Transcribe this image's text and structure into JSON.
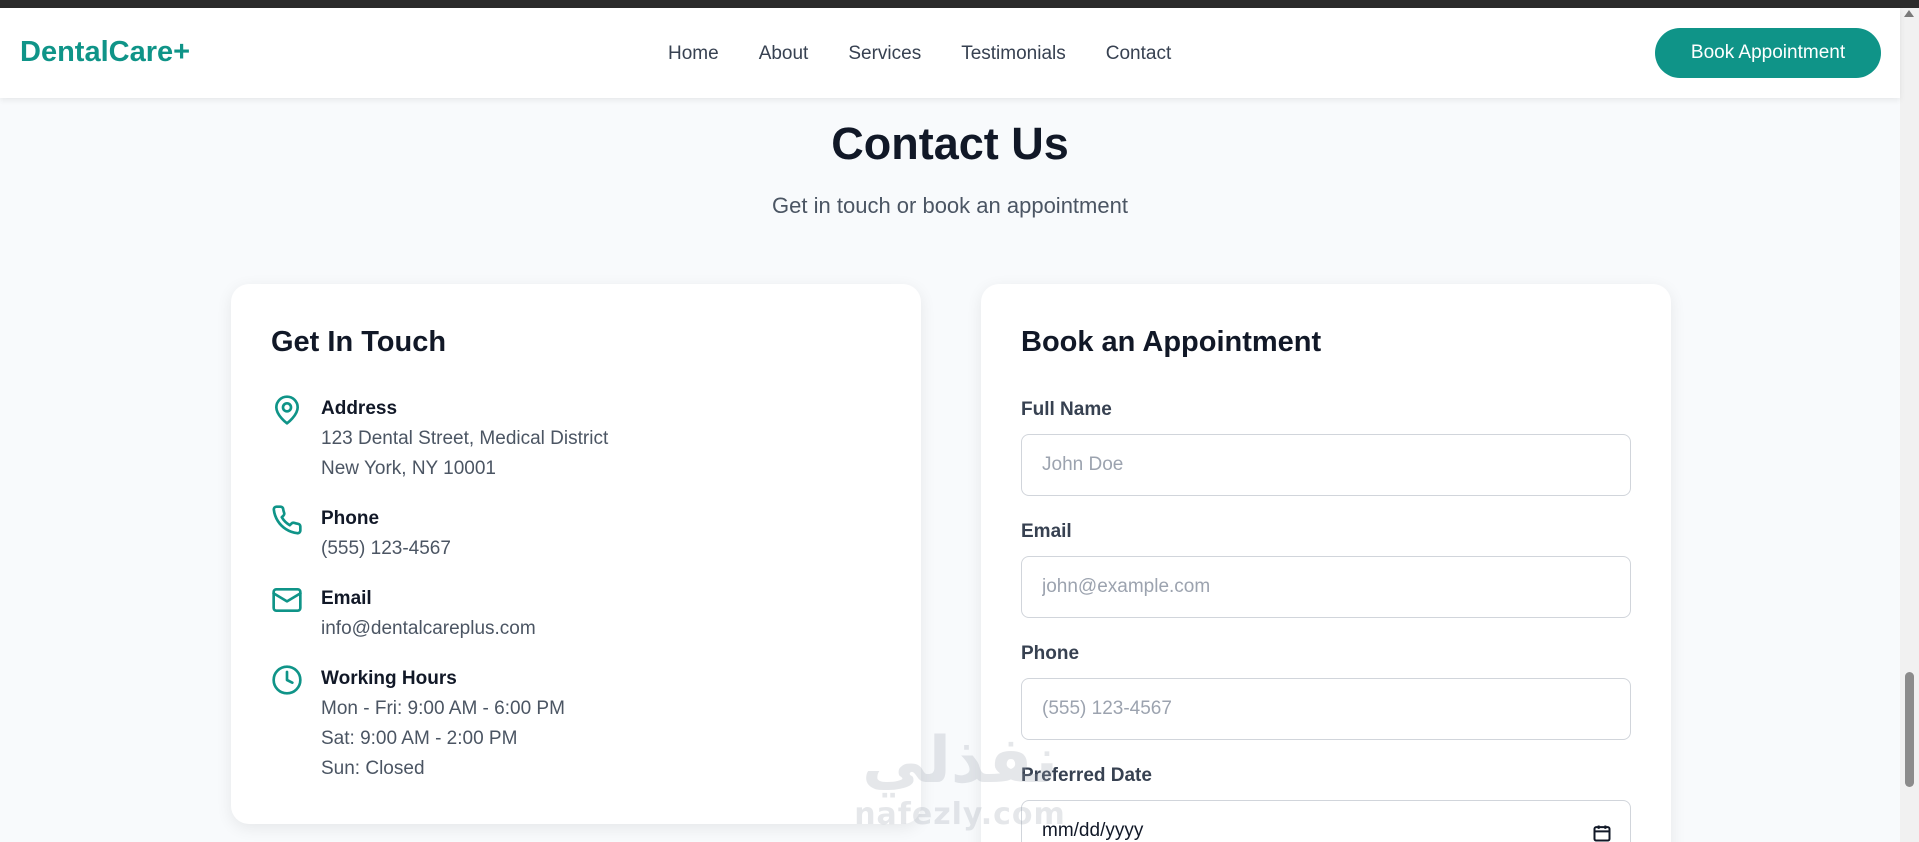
{
  "brand": {
    "logo": "DentalCare+",
    "accent_color": "#0f9488"
  },
  "nav": {
    "links": [
      "Home",
      "About",
      "Services",
      "Testimonials",
      "Contact"
    ],
    "cta": "Book Appointment"
  },
  "section": {
    "title": "Contact Us",
    "subtitle": "Get in touch or book an appointment"
  },
  "contact": {
    "title": "Get In Touch",
    "items": [
      {
        "icon": "map-pin-icon",
        "label": "Address",
        "lines": [
          "123 Dental Street, Medical District",
          "New York, NY 10001"
        ]
      },
      {
        "icon": "phone-icon",
        "label": "Phone",
        "lines": [
          "(555) 123-4567"
        ]
      },
      {
        "icon": "mail-icon",
        "label": "Email",
        "lines": [
          "info@dentalcareplus.com"
        ]
      },
      {
        "icon": "clock-icon",
        "label": "Working Hours",
        "lines": [
          "Mon - Fri: 9:00 AM - 6:00 PM",
          "Sat: 9:00 AM - 2:00 PM",
          "Sun: Closed"
        ]
      }
    ]
  },
  "booking": {
    "title": "Book an Appointment",
    "fields": {
      "name": {
        "label": "Full Name",
        "placeholder": "John Doe",
        "value": ""
      },
      "email": {
        "label": "Email",
        "placeholder": "john@example.com",
        "value": ""
      },
      "phone": {
        "label": "Phone",
        "placeholder": "(555) 123-4567",
        "value": ""
      },
      "date": {
        "label": "Preferred Date",
        "placeholder": "mm/dd/yyyy"
      }
    }
  },
  "watermark": {
    "arabic": "نفذلي",
    "latin": "nafezly.com"
  }
}
